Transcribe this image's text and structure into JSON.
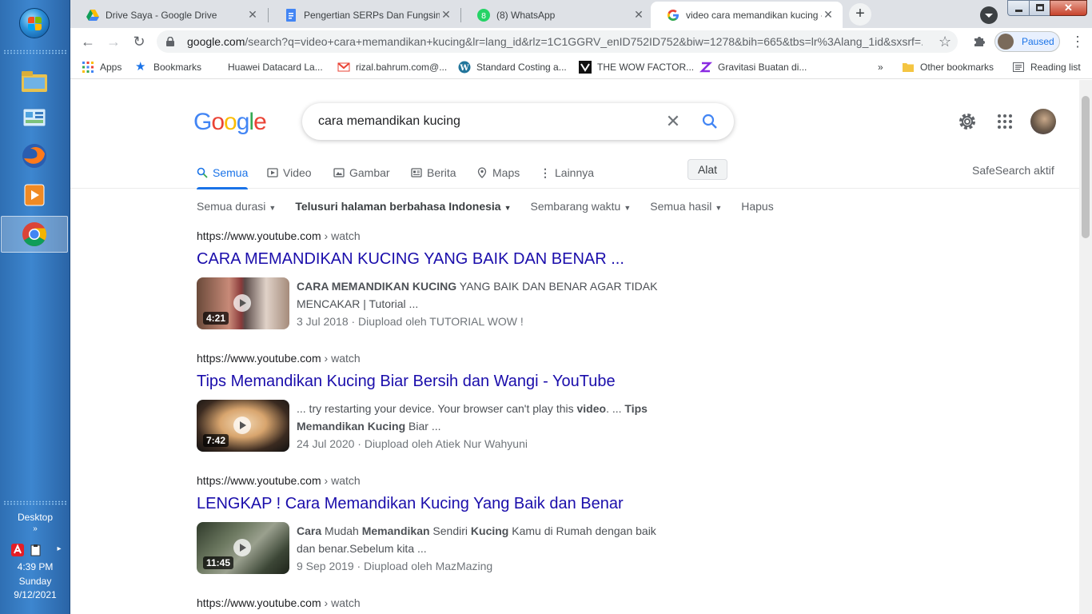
{
  "taskbar": {
    "desktop_label": "Desktop",
    "time": "4:39 PM",
    "day": "Sunday",
    "date": "9/12/2021"
  },
  "tabs": [
    {
      "title": "Drive Saya - Google Drive",
      "icon": "google-drive-icon"
    },
    {
      "title": "Pengertian SERPs Dan Fungsinya",
      "icon": "google-docs-icon"
    },
    {
      "title": "(8) WhatsApp",
      "icon": "whatsapp-icon"
    },
    {
      "title": "video cara memandikan kucing - ",
      "icon": "google-icon"
    }
  ],
  "omnibox": {
    "host": "google.com",
    "path": "/search?q=video+cara+memandikan+kucing&lr=lang_id&rlz=1C1GGRV_enID752ID752&biw=1278&bih=665&tbs=lr%3Alang_1id&sxsrf=..."
  },
  "profile": {
    "status": "Paused"
  },
  "bookmarks": {
    "items": [
      "Apps",
      "Bookmarks",
      "Huawei Datacard La...",
      "rizal.bahrum.com@...",
      "Standard Costing a...",
      "THE WOW FACTOR...",
      "Gravitasi Buatan di..."
    ],
    "overflow": "»",
    "other": "Other bookmarks",
    "reading": "Reading list"
  },
  "search": {
    "logo": "Google",
    "query": "cara memandikan kucing",
    "tabs": [
      "Semua",
      "Video",
      "Gambar",
      "Berita",
      "Maps",
      "Lainnya"
    ],
    "tools": "Alat",
    "safesearch": "SafeSearch aktif",
    "filters": [
      "Semua durasi",
      "Telusuri halaman berbahasa Indonesia",
      "Sembarang waktu",
      "Semua hasil",
      "Hapus"
    ]
  },
  "results": [
    {
      "url": "https://www.youtube.com",
      "crumb": "› watch",
      "title": "CARA MEMANDIKAN KUCING YANG BAIK DAN BENAR ...",
      "duration": "4:21",
      "snippet_bold": "CARA MEMANDIKAN KUCING",
      "snippet_rest": " YANG BAIK DAN BENAR AGAR TIDAK MENCAKAR | Tutorial ...",
      "date": "3 Jul 2018 · Diupload oleh TUTORIAL WOW !"
    },
    {
      "url": "https://www.youtube.com",
      "crumb": "› watch",
      "title": "Tips Memandikan Kucing Biar Bersih dan Wangi - YouTube",
      "duration": "7:42",
      "snippet_a": "... try restarting your device. Your browser can't play this ",
      "snippet_b1": "video",
      "snippet_c": ". ... ",
      "snippet_b2": "Tips Memandikan Kucing",
      "snippet_d": " Biar ...",
      "date": "24 Jul 2020 · Diupload oleh Atiek Nur Wahyuni"
    },
    {
      "url": "https://www.youtube.com",
      "crumb": "› watch",
      "title": "LENGKAP ! Cara Memandikan Kucing Yang Baik dan Benar",
      "duration": "11:45",
      "snippet_b1": "Cara",
      "snippet_a": " Mudah ",
      "snippet_b2": "Memandikan",
      "snippet_c": " Sendiri ",
      "snippet_b3": "Kucing",
      "snippet_d": " Kamu di Rumah dengan baik dan benar.Sebelum kita ...",
      "date": "9 Sep 2019 · Diupload oleh MazMazing"
    },
    {
      "url": "https://www.youtube.com",
      "crumb": "› watch"
    }
  ],
  "colors": {
    "link": "#1a0dab",
    "accent": "#1a73e8"
  }
}
